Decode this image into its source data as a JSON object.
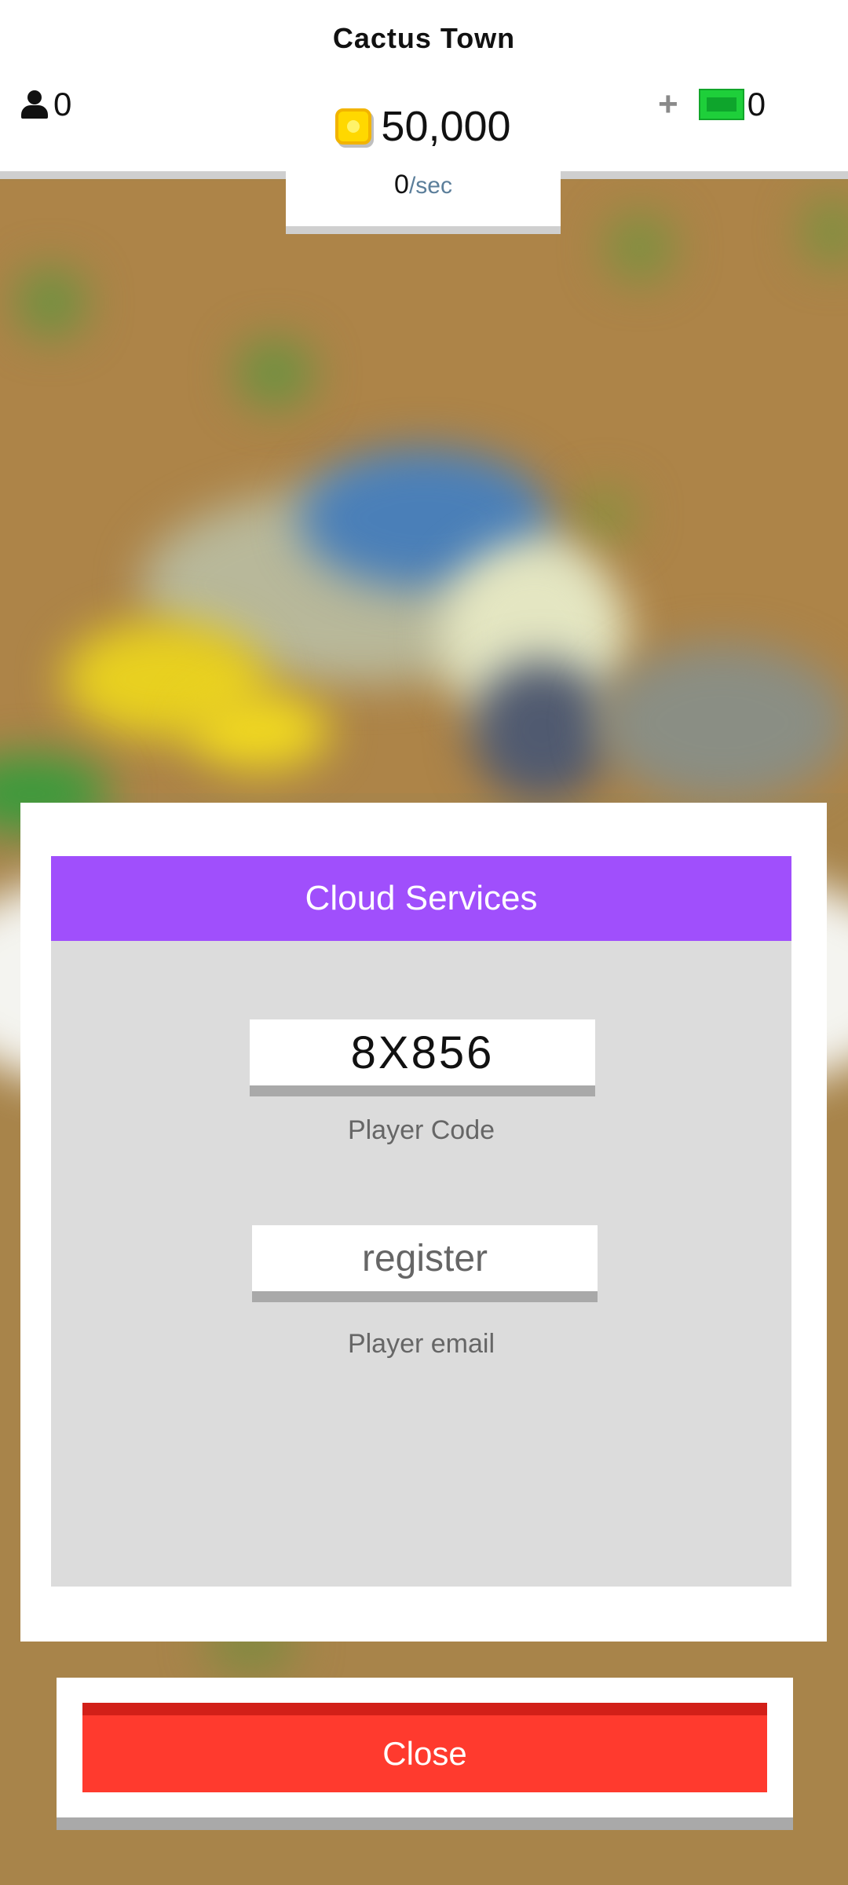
{
  "hud": {
    "town_name": "Cactus Town",
    "population": "0",
    "coins": "50,000",
    "rate_value": "0",
    "rate_unit": "/sec",
    "cash_add": "+",
    "cash": "0",
    "icons": [
      "person-icon",
      "coin-icon",
      "plus-icon",
      "banknote-icon"
    ]
  },
  "modal": {
    "title": "Cloud Services",
    "player_code": "8X856",
    "player_code_label": "Player Code",
    "email_value": "register",
    "email_label": "Player email",
    "close_label": "Close"
  },
  "colors": {
    "header_purple": "#a04ffc",
    "close_red": "#ff3a2e",
    "close_red_dark": "#d21f18",
    "panel_gray": "#dcdcdc",
    "ground": "#a8844a"
  }
}
